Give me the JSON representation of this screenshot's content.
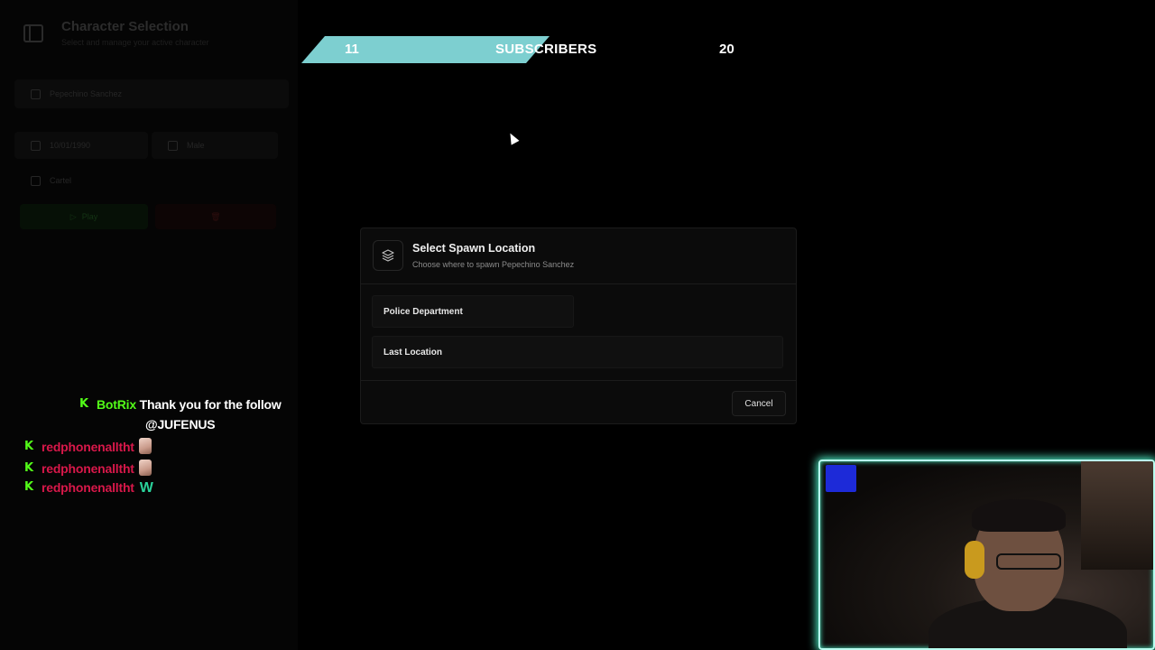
{
  "left_panel": {
    "title": "Character Selection",
    "subtitle": "Select and manage your active character",
    "character_name": "Pepechino Sanchez",
    "dob": "10/01/1990",
    "gender": "Male",
    "job": "Cartel",
    "play_label": "Play"
  },
  "subbar": {
    "current": "11",
    "label": "SUBSCRIBERS",
    "goal": "20",
    "progress": 0.55,
    "color": "#7dcfd0"
  },
  "modal": {
    "icon": "layers-icon",
    "title": "Select Spawn Location",
    "subtitle": "Choose where to spawn Pepechino Sanchez",
    "options": [
      {
        "label": "Police Department"
      },
      {
        "label": "Last Location"
      }
    ],
    "cancel_label": "Cancel"
  },
  "chat": {
    "platform_icon": "kick-icon",
    "messages": [
      {
        "user": "BotRix",
        "text": "Thank you for the follow",
        "text2": "@JUFENUS"
      },
      {
        "user": "redphonenalltht",
        "emote": "face-emote"
      },
      {
        "user": "redphonenalltht",
        "emote": "face-emote"
      },
      {
        "user": "redphonenalltht",
        "text": "W"
      }
    ],
    "colors": {
      "bot": "#53fc18",
      "user": "#d8184a"
    }
  },
  "webcam": {
    "border_color": "#4ef0c8"
  }
}
